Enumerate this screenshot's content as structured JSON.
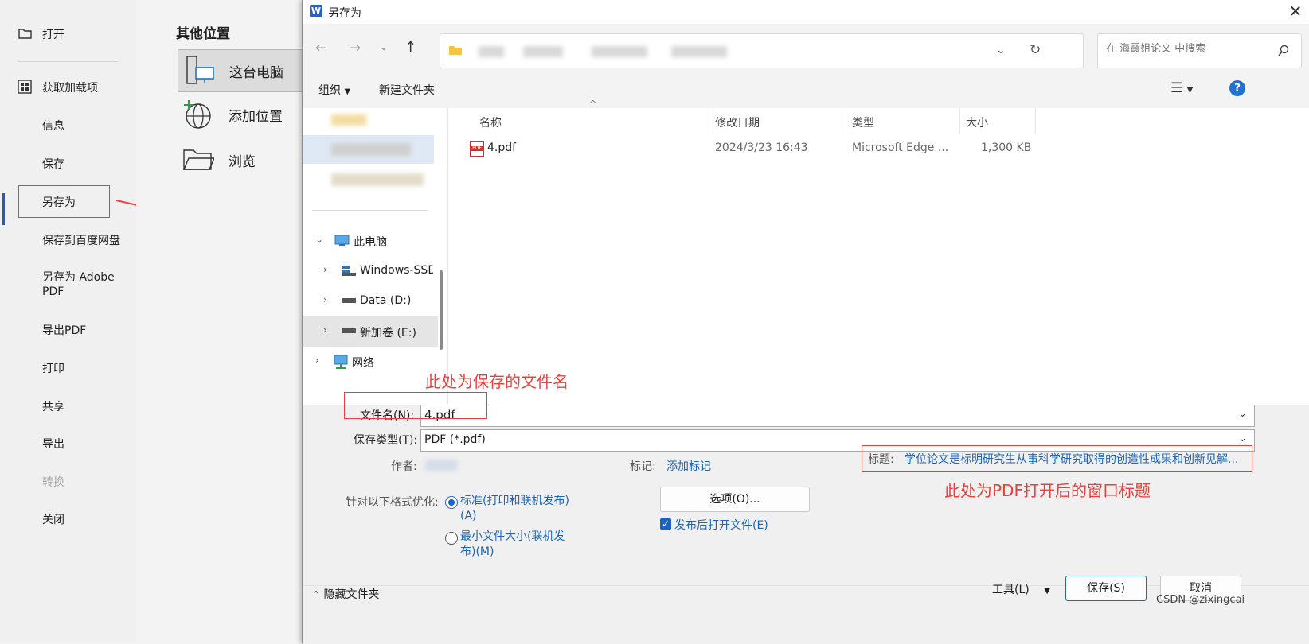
{
  "sidebar": {
    "open": "打开",
    "addins": "获取加载项",
    "info": "信息",
    "save": "保存",
    "save_as": "另存为",
    "save_baidu": "保存到百度网盘",
    "save_adobe": "另存为 Adobe PDF",
    "export_pdf": "导出PDF",
    "print": "打印",
    "share": "共享",
    "export": "导出",
    "convert": "转换",
    "close": "关闭"
  },
  "locations": {
    "heading": "其他位置",
    "this_pc": "这台电脑",
    "add_place": "添加位置",
    "browse": "浏览"
  },
  "dialog": {
    "title": "另存为",
    "search_placeholder": "在 海霞姐论文 中搜索",
    "toolbar": {
      "organize": "组织",
      "new_folder": "新建文件夹"
    },
    "tree": {
      "this_pc": "此电脑",
      "drive_c": "Windows-SSD",
      "drive_d": "Data (D:)",
      "drive_e": "新加卷 (E:)",
      "network": "网络"
    },
    "columns": {
      "name": "名称",
      "date": "修改日期",
      "type": "类型",
      "size": "大小"
    },
    "files": [
      {
        "name": "4.pdf",
        "date": "2024/3/23 16:43",
        "type": "Microsoft Edge ...",
        "size": "1,300 KB"
      }
    ],
    "form": {
      "filename_label": "文件名(N):",
      "filename_value": "4.pdf",
      "filetype_label": "保存类型(T):",
      "filetype_value": "PDF (*.pdf)",
      "author_label": "作者:",
      "tags_label": "标记:",
      "tags_link": "添加标记",
      "title_label": "标题:",
      "title_value": "学位论文是标明研究生从事科学研究取得的创造性成果和创新见解...",
      "optimize_label": "针对以下格式优化:",
      "opt_standard": "标准(打印和联机发布)(A)",
      "opt_min": "最小文件大小(联机发布)(M)",
      "options_button": "选项(O)...",
      "open_after": "发布后打开文件(E)"
    },
    "footer": {
      "hide_folders": "隐藏文件夹",
      "tools": "工具(L)",
      "save": "保存(S)",
      "cancel": "取消"
    }
  },
  "annotations": {
    "filename_note": "此处为保存的文件名",
    "title_note": "此处为PDF打开后的窗口标题"
  },
  "watermark": "CSDN @zixingcai"
}
